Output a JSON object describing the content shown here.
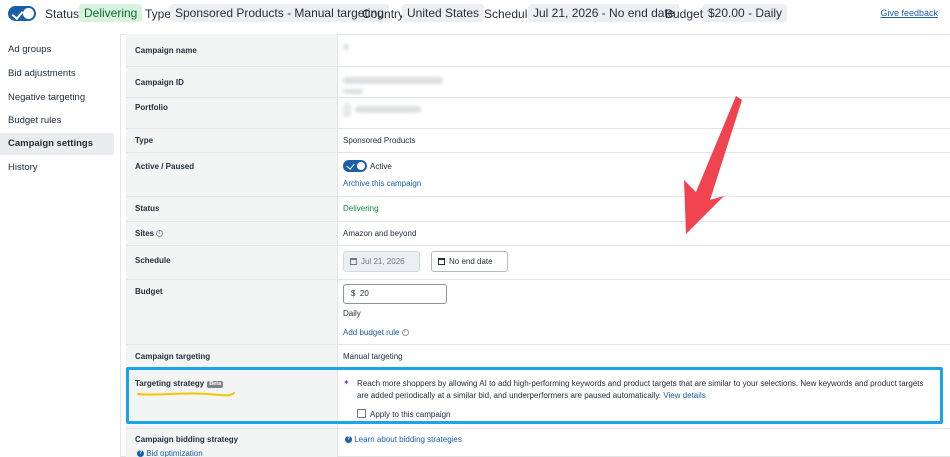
{
  "topbar": {
    "status_label": "Status:",
    "status_value": "Delivering",
    "type_label": "Type:",
    "type_value": "Sponsored Products - Manual targeting",
    "country_label": "Country:",
    "country_value": "United States",
    "schedule_label": "Schedule:",
    "schedule_value": "Jul 21, 2026 - No end date",
    "budget_label": "Budget:",
    "budget_value": "$20.00 - Daily",
    "feedback_link": "Give feedback"
  },
  "nav": {
    "items": [
      {
        "label": "Ad groups"
      },
      {
        "label": "Bid adjustments"
      },
      {
        "label": "Negative targeting"
      },
      {
        "label": "Budget rules"
      },
      {
        "label": "Campaign settings",
        "active": true
      },
      {
        "label": "History"
      }
    ]
  },
  "settings": {
    "campaign_name_label": "Campaign name",
    "campaign_id_label": "Campaign ID",
    "portfolio_label": "Portfolio",
    "type_label": "Type",
    "type_value": "Sponsored Products",
    "active_label": "Active / Paused",
    "active_value": "Active",
    "archive_link": "Archive this campaign",
    "status_label": "Status",
    "status_value": "Delivering",
    "sites_label": "Sites",
    "sites_value": "Amazon and beyond",
    "schedule_label": "Schedule",
    "start_date": "Jul 21, 2026",
    "end_date": "No end date",
    "budget_label": "Budget",
    "budget_currency": "$",
    "budget_amount": "20",
    "budget_period": "Daily",
    "add_budget_rule": "Add budget rule",
    "targeting_label": "Campaign targeting",
    "targeting_value": "Manual targeting",
    "strategy_label": "Targeting strategy",
    "strategy_badge": "Beta",
    "strategy_text": "Reach more shoppers by allowing AI to add high-performing keywords and product targets that are similar to your selections. New keywords and product targets are added periodically at a similar bid, and underperformers are paused automatically.",
    "strategy_link": "View details",
    "apply_checkbox": "Apply to this campaign",
    "bidding_label": "Campaign bidding strategy",
    "bid_optimization": "Bid optimization",
    "learn_bidding": "Learn about bidding strategies"
  },
  "colors": {
    "brand_blue": "#1b5fa8",
    "status_green": "#0f8a3a",
    "highlight_blue": "#1aa5ea",
    "arrow_red": "#ef4350",
    "scribble_yellow": "#f5c400"
  }
}
